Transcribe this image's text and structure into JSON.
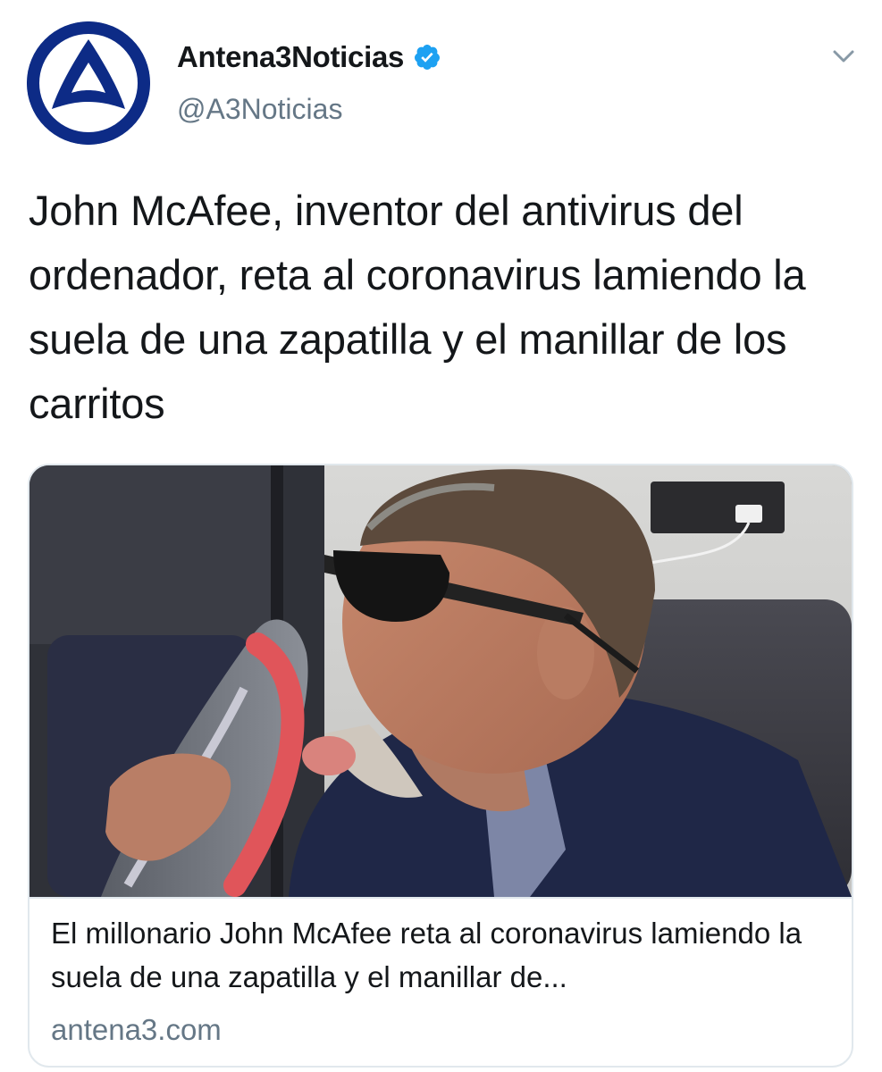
{
  "account": {
    "display_name": "Antena3Noticias",
    "handle": "@A3Noticias",
    "verified": true,
    "avatar_icon": "antena3-logo-icon",
    "brand_color": "#0d2b86"
  },
  "tweet": {
    "text": "John McAfee, inventor del antivirus del ordenador, reta al coronavirus lamiendo la suela de una zapatilla y el manillar de los carritos"
  },
  "link_card": {
    "image_icon": "article-photo",
    "title": "El millonario John McAfee reta al coronavirus lamiendo la suela de una zapatilla y el manillar de...",
    "domain": "antena3.com"
  },
  "colors": {
    "verified_blue": "#1da1f2",
    "secondary_text": "#657786",
    "border": "#e1e8ed"
  }
}
